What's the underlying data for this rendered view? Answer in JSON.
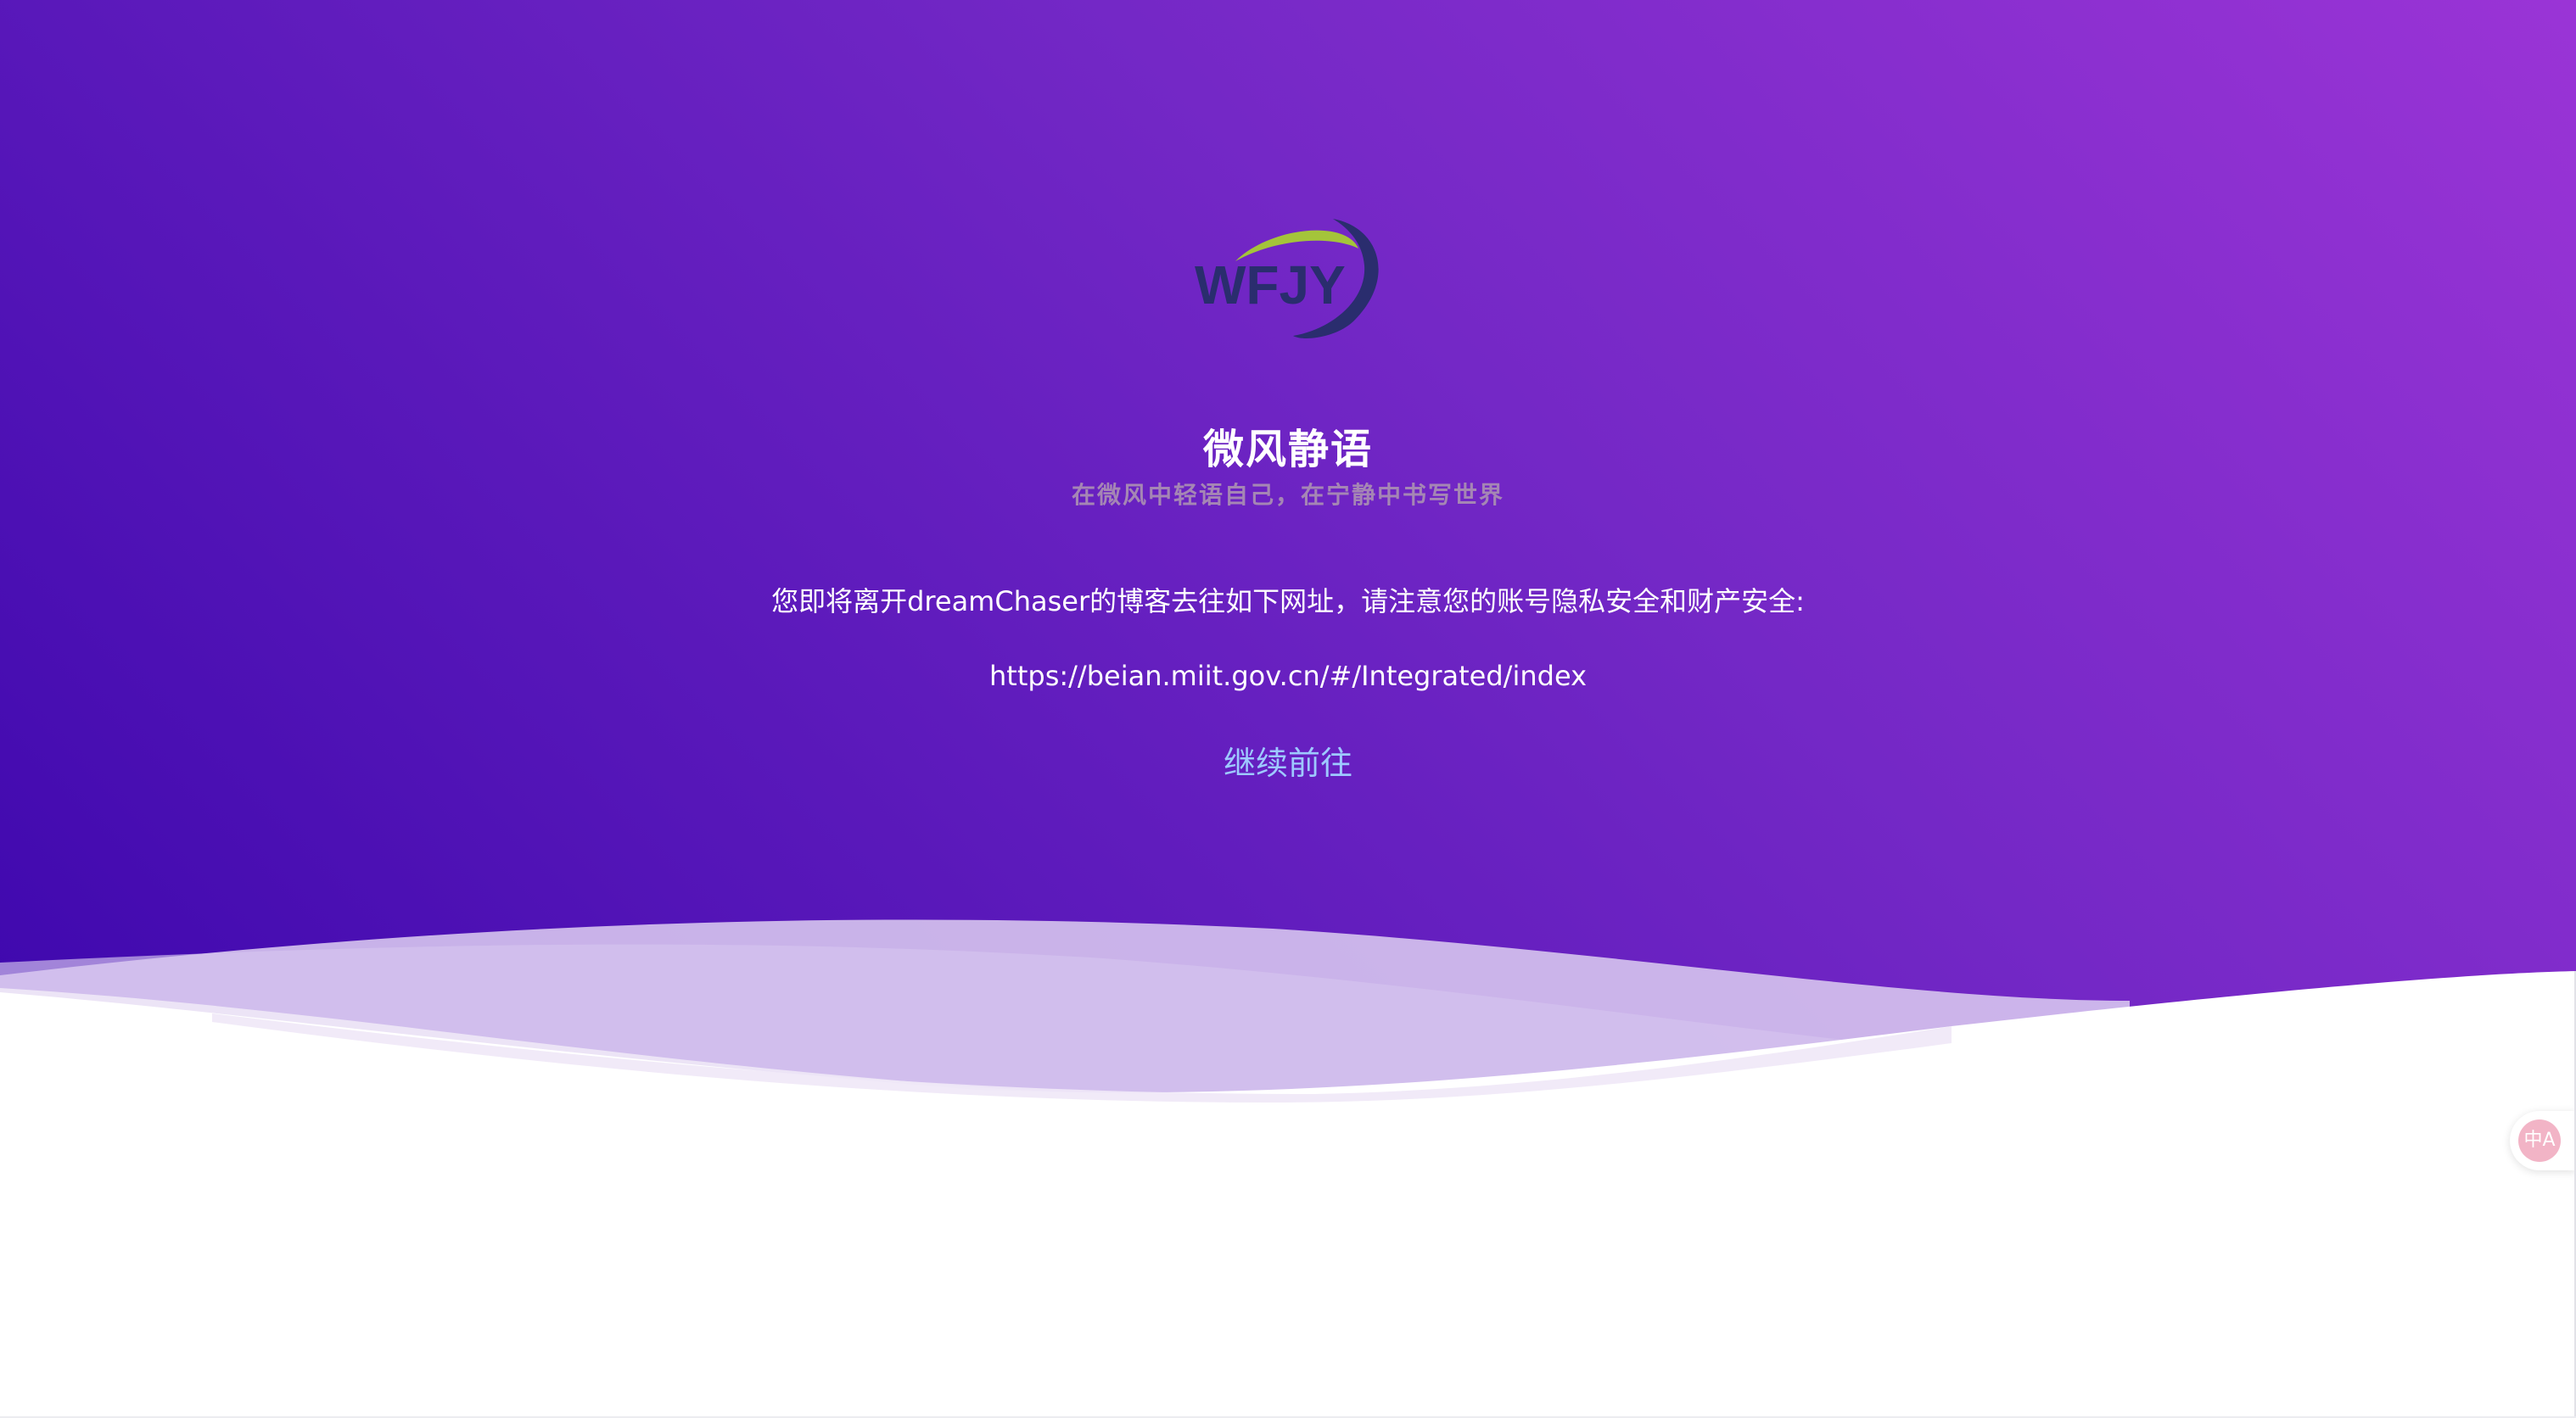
{
  "logo": {
    "text": "WFJY",
    "colors": {
      "letters": "#2a2d6e",
      "arc_green": "#a4c43a",
      "arc_navy": "#2a2d6e"
    }
  },
  "site": {
    "title": "微风静语",
    "subtitle": "在微风中轻语自己，在宁静中书写世界"
  },
  "redirect": {
    "notice": "您即将离开dreamChaser的博客去往如下网址，请注意您的账号隐私安全和财产安全:",
    "url": "https://beian.miit.gov.cn/#/Integrated/index",
    "continue_label": "继续前往"
  },
  "translate_button": {
    "icon": "translate-icon",
    "glyph": "中A"
  },
  "colors": {
    "gradient_start": "#3d07ad",
    "gradient_end": "#9a34d6",
    "subtitle": "#a586b4",
    "link": "#9ec9ff",
    "translate_badge": "#f2b4c6"
  }
}
